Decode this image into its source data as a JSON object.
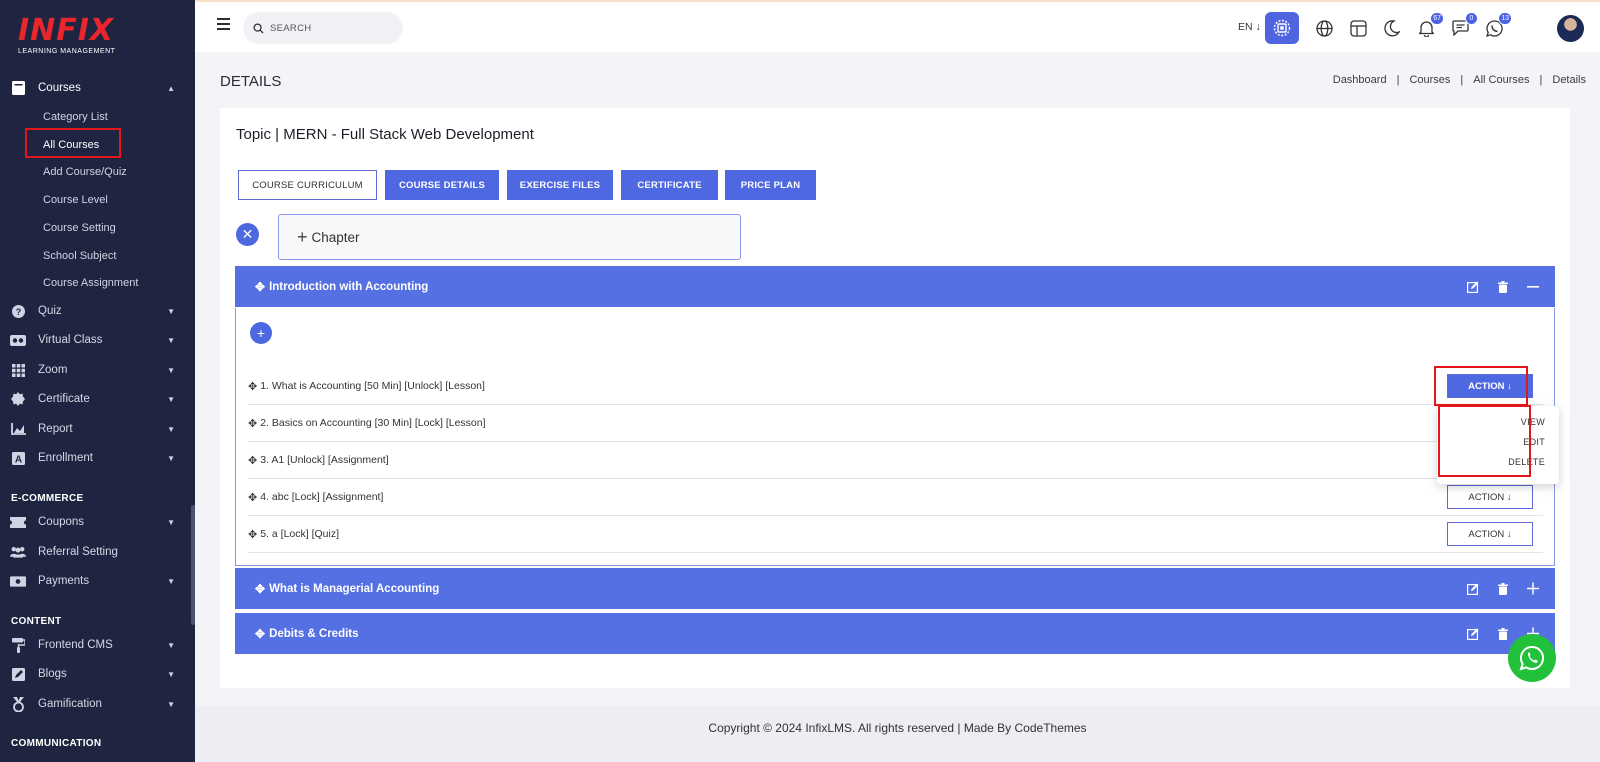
{
  "brand": {
    "logo": "INFIX",
    "tagline": "LEARNING MANAGEMENT"
  },
  "sidebar": {
    "courses": {
      "label": "Courses",
      "subitems": [
        "Category List",
        "All Courses",
        "Add Course/Quiz",
        "Course Level",
        "Course Setting",
        "School Subject",
        "Course Assignment"
      ]
    },
    "items": [
      {
        "label": "Quiz",
        "icon": "question-icon"
      },
      {
        "label": "Virtual Class",
        "icon": "vr-icon"
      },
      {
        "label": "Zoom",
        "icon": "grid-icon"
      },
      {
        "label": "Certificate",
        "icon": "certificate-icon"
      },
      {
        "label": "Report",
        "icon": "chart-icon"
      },
      {
        "label": "Enrollment",
        "icon": "enrollment-icon"
      }
    ],
    "ecommerce_title": "E-COMMERCE",
    "ecommerce": [
      {
        "label": "Coupons",
        "icon": "coupon-icon"
      },
      {
        "label": "Referral Setting",
        "icon": "users-icon"
      },
      {
        "label": "Payments",
        "icon": "payment-icon"
      }
    ],
    "content_title": "CONTENT",
    "content": [
      {
        "label": "Frontend CMS",
        "icon": "paint-roller-icon"
      },
      {
        "label": "Blogs",
        "icon": "edit-icon"
      },
      {
        "label": "Gamification",
        "icon": "medal-icon"
      }
    ],
    "communication_title": "COMMUNICATION"
  },
  "topbar": {
    "search_placeholder": "SEARCH",
    "language": "EN ↓",
    "notifications": "67",
    "messages": "0",
    "whatsapp": "13"
  },
  "page": {
    "heading": "DETAILS",
    "breadcrumb": [
      "Dashboard",
      "Courses",
      "All Courses",
      "Details"
    ]
  },
  "topic": {
    "title": "Topic | MERN - Full Stack Web Development",
    "tabs": [
      "COURSE CURRICULUM",
      "COURSE DETAILS",
      "EXERCISE FILES",
      "CERTIFICATE",
      "PRICE PLAN"
    ],
    "chapter_placeholder": "Chapter"
  },
  "chapters": [
    {
      "title": "Introduction with Accounting"
    },
    {
      "title": "What is Managerial Accounting"
    },
    {
      "title": "Debits & Credits"
    }
  ],
  "lessons": [
    "1. What is Accounting [50 Min] [Unlock] [Lesson]",
    "2. Basics on Accounting [30 Min] [Lock] [Lesson]",
    "3. A1 [Unlock] [Assignment]",
    "4. abc [Lock] [Assignment]",
    "5. a [Lock] [Quiz]"
  ],
  "action_label": "ACTION ↓",
  "dropdown": [
    "VIEW",
    "EDIT",
    "DELETE"
  ],
  "footer": "Copyright © 2024 InfixLMS. All rights reserved | Made By CodeThemes",
  "colors": {
    "sidebar": "#1f2540",
    "accent": "#4e68e1",
    "highlight": "#e3161c"
  }
}
